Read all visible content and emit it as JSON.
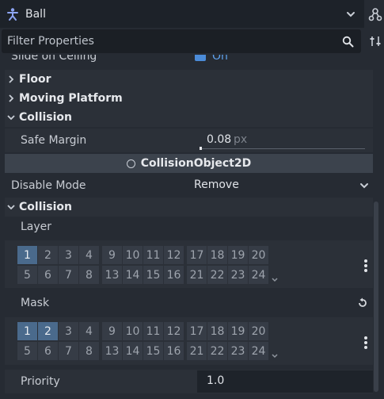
{
  "node_selector": {
    "name": "Ball",
    "icon": "character-body-icon",
    "chevron": "chevron-down-icon"
  },
  "toolbar": {
    "node_button_icon": "node-tree-icon",
    "sort_button_icon": "sort-icon"
  },
  "filter": {
    "placeholder": "Filter Properties",
    "icon": "search-icon"
  },
  "inspector": {
    "slide_on_ceiling": {
      "label": "Slide on Ceiling",
      "value": "On"
    },
    "floor": {
      "label": "Floor"
    },
    "moving_platform": {
      "label": "Moving Platform"
    },
    "collision_section_1": {
      "label": "Collision"
    },
    "safe_margin": {
      "label": "Safe Margin",
      "value": "0.08",
      "unit": "px"
    },
    "class_header": {
      "label": "CollisionObject2D"
    },
    "disable_mode": {
      "label": "Disable Mode",
      "value": "Remove"
    },
    "collision_section_2": {
      "label": "Collision"
    },
    "layer": {
      "label": "Layer",
      "cells": [
        "1",
        "2",
        "3",
        "4",
        "9",
        "10",
        "11",
        "12",
        "17",
        "18",
        "19",
        "20",
        "5",
        "6",
        "7",
        "8",
        "13",
        "14",
        "15",
        "16",
        "21",
        "22",
        "23",
        "24"
      ],
      "enabled": [
        "1"
      ]
    },
    "mask": {
      "label": "Mask",
      "cells": [
        "1",
        "2",
        "3",
        "4",
        "9",
        "10",
        "11",
        "12",
        "17",
        "18",
        "19",
        "20",
        "5",
        "6",
        "7",
        "8",
        "13",
        "14",
        "15",
        "16",
        "21",
        "22",
        "23",
        "24"
      ],
      "enabled": [
        "1",
        "2"
      ]
    },
    "priority": {
      "label": "Priority",
      "value": "1.0"
    }
  },
  "colors": {
    "background": "#262b33",
    "accent": "#4a6a8c",
    "check": "#4b8bd8"
  }
}
